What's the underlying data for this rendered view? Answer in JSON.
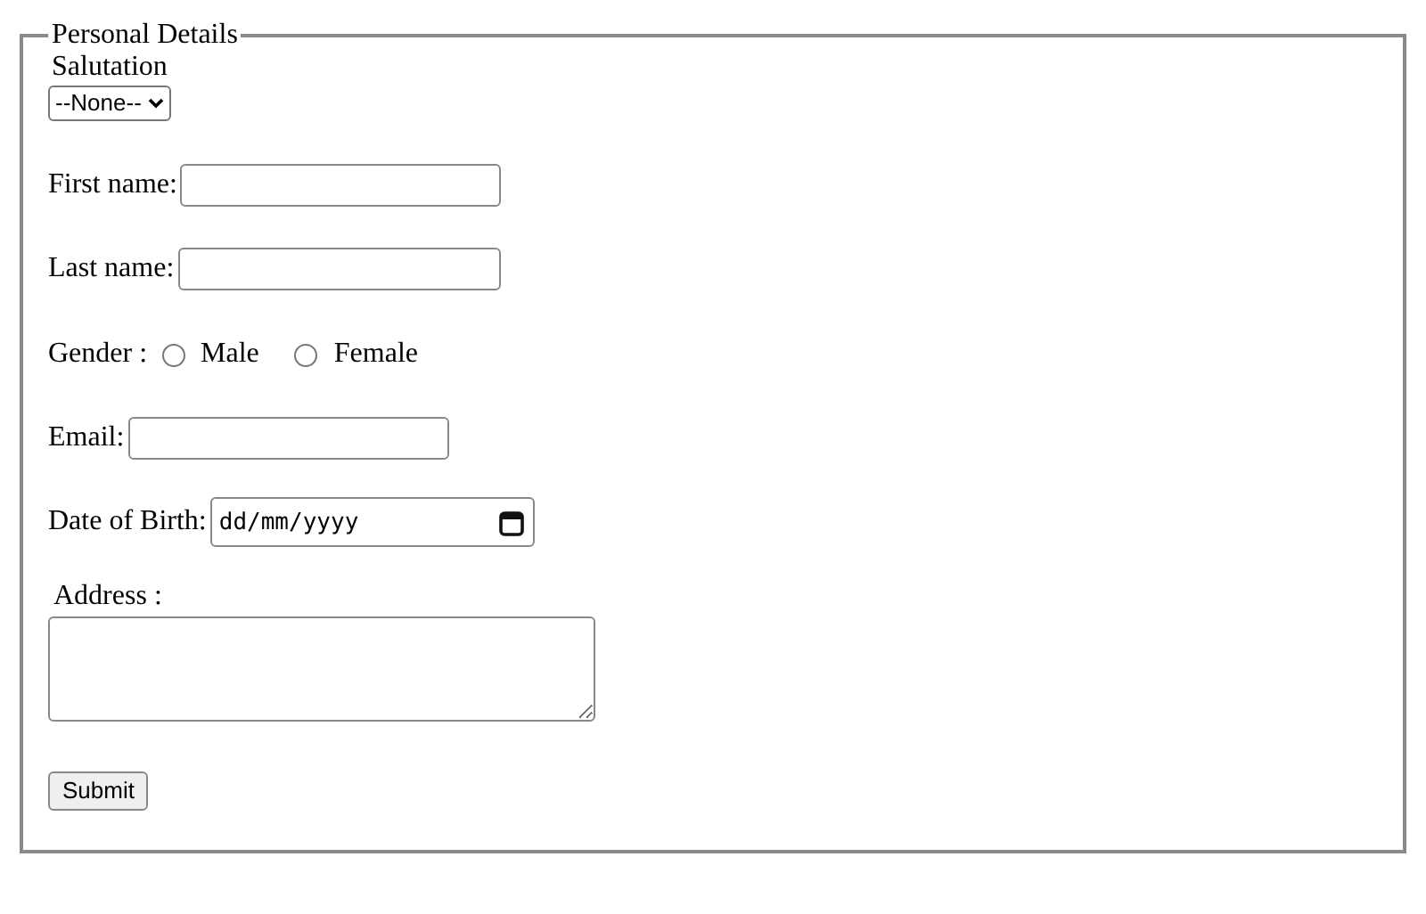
{
  "fieldset": {
    "legend": "Personal Details"
  },
  "salutation": {
    "label": "Salutation",
    "value": "--None--"
  },
  "fields": [
    {
      "kind": "text",
      "label": "First name:"
    },
    {
      "kind": "text",
      "label": "Last name:"
    },
    {
      "kind": "radio",
      "label": "Gender :",
      "options": [
        {
          "label": "Male",
          "selected": false
        },
        {
          "label": "Female",
          "selected": false
        }
      ]
    },
    {
      "kind": "text",
      "label": "Email:"
    },
    {
      "kind": "date",
      "label": "Date of Birth:",
      "placeholder": "dd/mm/yyyy"
    }
  ],
  "address": {
    "label": "Address :"
  },
  "submit": "Submit"
}
